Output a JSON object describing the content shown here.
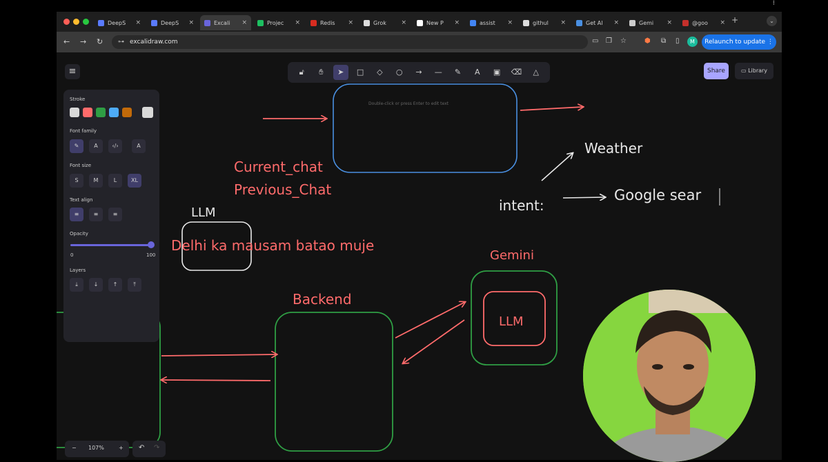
{
  "browser": {
    "tabs": [
      {
        "title": "DeepS",
        "color": "#5a7bff"
      },
      {
        "title": "DeepS",
        "color": "#5a7bff"
      },
      {
        "title": "Excali",
        "color": "#6965db",
        "active": true
      },
      {
        "title": "Projec",
        "color": "#1dbf60"
      },
      {
        "title": "Redis",
        "color": "#d82c20"
      },
      {
        "title": "Grok",
        "color": "#dddddd"
      },
      {
        "title": "New P",
        "color": "#ffffff"
      },
      {
        "title": "assist",
        "color": "#4285f4"
      },
      {
        "title": "githul",
        "color": "#dddddd"
      },
      {
        "title": "Get Al",
        "color": "#4a90e2"
      },
      {
        "title": "Gemi",
        "color": "#cccccc"
      },
      {
        "title": "@goo",
        "color": "#c4302b"
      }
    ],
    "url": "excalidraw.com",
    "profile_initial": "M",
    "relaunch_label": "Relaunch to update"
  },
  "excalidraw": {
    "share_label": "Share",
    "library_label": "Library",
    "hint_text": "Double-click or press Enter to edit text",
    "props": {
      "stroke_label": "Stroke",
      "stroke_colors": [
        "#d9d9d9",
        "#ff6b6b",
        "#2f9e44",
        "#4dabf7",
        "#c26a0a"
      ],
      "font_family_label": "Font family",
      "font_size_label": "Font size",
      "font_sizes": [
        "S",
        "M",
        "L",
        "XL"
      ],
      "text_align_label": "Text align",
      "opacity_label": "Opacity",
      "opacity_min": "0",
      "opacity_max": "100",
      "layers_label": "Layers"
    },
    "zoom_level": "107%"
  },
  "canvas_text": {
    "current_chat": "Current_chat",
    "previous_chat": "Previous_Chat",
    "llm_top": "LLM",
    "query": "Delhi ka mausam batao muje",
    "weather": "Weather",
    "intent": "intent:",
    "google": "Google sear",
    "gemini": "Gemini",
    "llm_inner": "LLM",
    "backend": "Backend"
  },
  "colors": {
    "red": "#ff6b6b",
    "blue": "#4a90e2",
    "green": "#2f9e44",
    "white": "#e8e8e8"
  }
}
